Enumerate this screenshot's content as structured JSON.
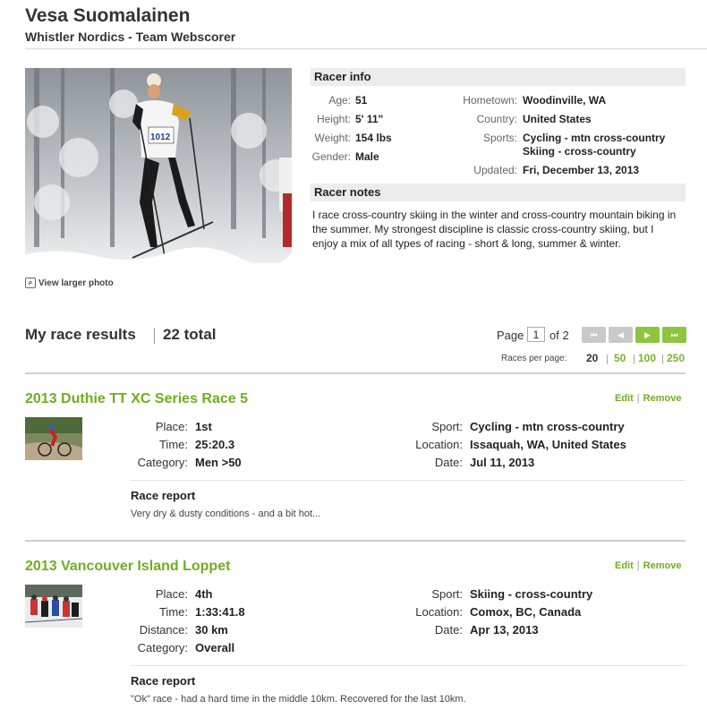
{
  "profile": {
    "name": "Vesa Suomalainen",
    "team": "Whistler Nordics - Team Webscorer",
    "view_larger": "View larger photo"
  },
  "racer_info": {
    "heading": "Racer info",
    "left": [
      {
        "label": "Age:",
        "value": "51"
      },
      {
        "label": "Height:",
        "value": "5' 11\""
      },
      {
        "label": "Weight:",
        "value": "154 lbs"
      },
      {
        "label": "Gender:",
        "value": "Male"
      }
    ],
    "hometown_label": "Hometown:",
    "hometown": "Woodinville, WA",
    "country_label": "Country:",
    "country": "United States",
    "sports_label": "Sports:",
    "sports_1": "Cycling - mtn cross-country",
    "sports_2": "Skiing - cross-country",
    "updated_label": "Updated:",
    "updated": "Fri, December 13, 2013"
  },
  "racer_notes": {
    "heading": "Racer notes",
    "text": "I race cross-country skiing in the winter and cross-country mountain biking in the summer. My strongest discipline is classic cross-country skiing, but I enjoy a mix of all types of racing - short & long, summer & winter."
  },
  "results": {
    "title": "My race results",
    "total": "22 total",
    "page_label": "Page",
    "page_current": "1",
    "page_of": "of 2",
    "per_page_label": "Races per page:",
    "per_page": [
      "20",
      "50",
      "100",
      "250"
    ]
  },
  "races": [
    {
      "title": "2013 Duthie TT XC Series Race 5",
      "edit": "Edit",
      "remove": "Remove",
      "left": [
        {
          "label": "Place:",
          "value": "1st"
        },
        {
          "label": "Time:",
          "value": "25:20.3"
        },
        {
          "label": "Category:",
          "value": "Men >50"
        }
      ],
      "right": [
        {
          "label": "Sport:",
          "value": "Cycling - mtn cross-country"
        },
        {
          "label": "Location:",
          "value": "Issaquah, WA, United States"
        },
        {
          "label": "Date:",
          "value": "Jul 11, 2013"
        }
      ],
      "report_head": "Race report",
      "report_text": "Very dry & dusty conditions - and a bit hot..."
    },
    {
      "title": "2013 Vancouver Island Loppet",
      "edit": "Edit",
      "remove": "Remove",
      "left": [
        {
          "label": "Place:",
          "value": "4th"
        },
        {
          "label": "Time:",
          "value": "1:33:41.8"
        },
        {
          "label": "Distance:",
          "value": "30 km"
        },
        {
          "label": "Category:",
          "value": "Overall"
        }
      ],
      "right": [
        {
          "label": "Sport:",
          "value": "Skiing - cross-country"
        },
        {
          "label": "Location:",
          "value": "Comox, BC, Canada"
        },
        {
          "label": "Date:",
          "value": "Apr 13, 2013"
        }
      ],
      "report_head": "Race report",
      "report_text": "\"Ok\" race - had a hard time in the middle 10km. Recovered for the last 10km."
    }
  ],
  "colors": {
    "accent_green": "#6fae1f",
    "button_green": "#8cc63f",
    "section_bg": "#ececec"
  }
}
